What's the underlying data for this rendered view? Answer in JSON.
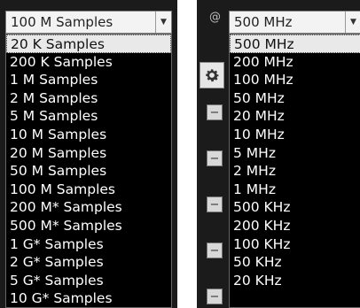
{
  "samples_dropdown": {
    "selected": "100 M Samples",
    "arrow": "chevron-down-icon",
    "options": [
      "20 K Samples",
      "200 K Samples",
      "1 M Samples",
      "2 M Samples",
      "5 M Samples",
      "10 M Samples",
      "20 M Samples",
      "50 M Samples",
      "100 M Samples",
      "200 M* Samples",
      "500 M* Samples",
      "1 G* Samples",
      "2 G* Samples",
      "5 G* Samples",
      "10 G* Samples"
    ]
  },
  "rate_dropdown": {
    "prefix": "@",
    "selected": "500 MHz",
    "arrow": "chevron-down-icon",
    "options": [
      "500 MHz",
      "200 MHz",
      "100 MHz",
      "50 MHz",
      "20 MHz",
      "10 MHz",
      "5 MHz",
      "2 MHz",
      "1 MHz",
      "500 KHz",
      "200 KHz",
      "100 KHz",
      "50 KHz",
      "20 KHz"
    ]
  },
  "icons": [
    "gear-icon",
    "minus-icon"
  ],
  "colors": {
    "panel_bg": "#1b1b1b",
    "list_bg": "#000000",
    "highlight_bg": "#e9e9e9",
    "strip": [
      "#c43c3c",
      "#d48a2e",
      "#3a62c8",
      "#3aa64a",
      "#8a3ac8"
    ]
  }
}
